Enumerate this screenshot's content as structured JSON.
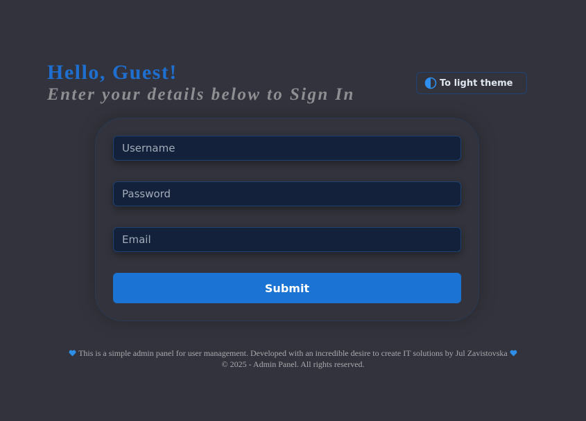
{
  "header": {
    "greeting": "Hello, Guest!",
    "subtitle": "Enter your details below to Sign In"
  },
  "theme_toggle": {
    "label": "To light theme",
    "icon": "half-circle-contrast-icon"
  },
  "form": {
    "username_placeholder": "Username",
    "password_placeholder": "Password",
    "email_placeholder": "Email",
    "submit_label": "Submit"
  },
  "footer": {
    "description": "This is a simple admin panel for user management. Developed with an incredible desire to create IT solutions by Jul Zavistovska",
    "heart_icon": "blue-heart-icon",
    "copyright": "© 2025 - Admin Panel. All rights reserved."
  },
  "colors": {
    "background": "#32333c",
    "accent": "#1b74d3",
    "greeting": "#1e6fd0",
    "subtitle": "#8f8f93",
    "field_background": "#13213a",
    "field_border": "#1e4372"
  }
}
